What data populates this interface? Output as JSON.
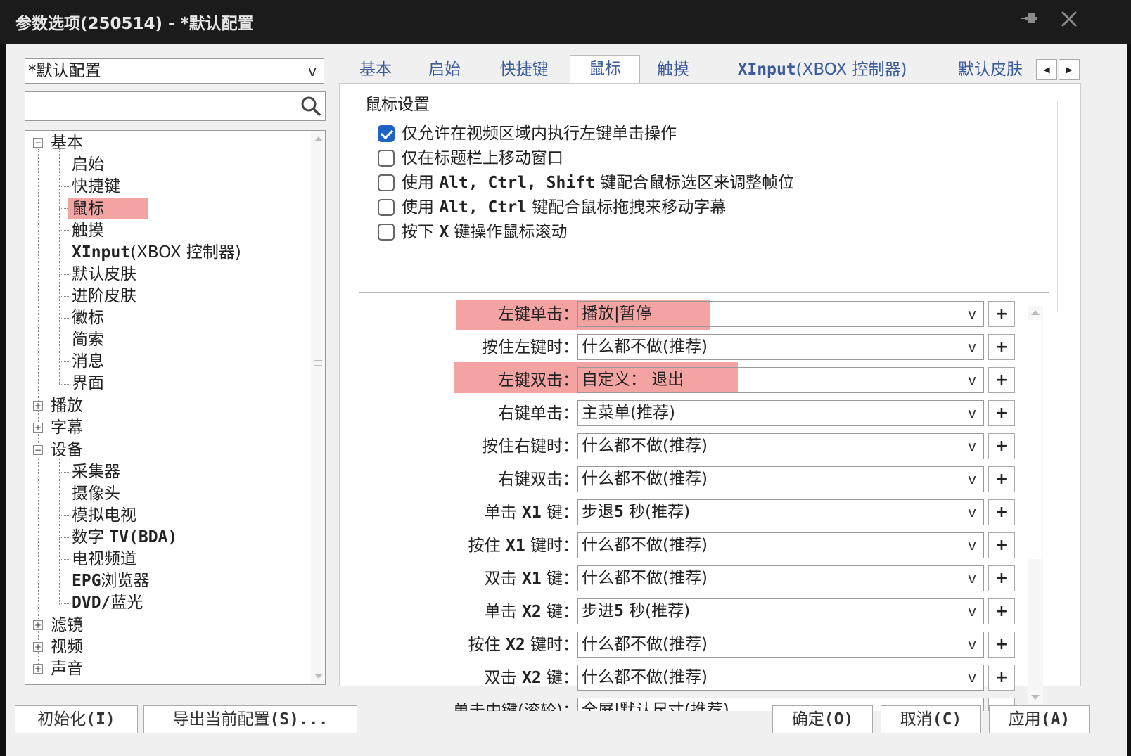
{
  "window": {
    "title": "参数选项(250514) - *默认配置"
  },
  "profile": {
    "selected": "*默认配置"
  },
  "search": {
    "placeholder": ""
  },
  "tree": {
    "basic": "基本",
    "basic_children": [
      "启始",
      "快捷键",
      "鼠标",
      "触摸",
      "XInput",
      "(XBOX 控制器)",
      "默认皮肤",
      "进阶皮肤",
      "徽标",
      "简索",
      "消息",
      "界面"
    ],
    "play": "播放",
    "subtitle": "字幕",
    "device": "设备",
    "device_children": [
      "采集器",
      "摄像头",
      "模拟电视",
      "数字 ",
      "TV(BDA)",
      "电视频道",
      "EPG",
      "浏览器",
      "DVD/",
      "蓝光"
    ],
    "filter": "滤镜",
    "video": "视频",
    "audio": "声音"
  },
  "tabs": {
    "basic": "基本",
    "start": "启始",
    "hotkey": "快捷键",
    "mouse": "鼠标",
    "touch": "触摸",
    "xinput": "XInput",
    "xinput_suffix": "(XBOX 控制器)",
    "skin": "默认皮肤"
  },
  "mouse": {
    "group_title": "鼠标设置",
    "options": [
      {
        "label": "仅允许在视频区域内执行左键单击操作",
        "checked": true
      },
      {
        "label": "仅在标题栏上移动窗口",
        "checked": false
      },
      {
        "label_pre": "使用 ",
        "label_keys": "Alt, Ctrl, Shift",
        "label_post": " 键配合鼠标选区来调整帧位",
        "checked": false
      },
      {
        "label_pre": "使用 ",
        "label_keys": "Alt, Ctrl",
        "label_post": " 键配合鼠标拖拽来移动字幕",
        "checked": false
      },
      {
        "label_pre": "按下 ",
        "label_keys": "X",
        "label_post": " 键操作鼠标滚动",
        "checked": false
      }
    ],
    "mappings": [
      {
        "label": "左键单击：",
        "value": "播放|暂停"
      },
      {
        "label": "按住左键时：",
        "value": "什么都不做(推荐)"
      },
      {
        "label": "左键双击：",
        "value": "自定义：  退出"
      },
      {
        "label": "右键单击：",
        "value": "主菜单(推荐)"
      },
      {
        "label": "按住右键时：",
        "value": "什么都不做(推荐)"
      },
      {
        "label": "右键双击：",
        "value": "什么都不做(推荐)"
      },
      {
        "label_pre": "单击 ",
        "label_key": "X1",
        "label_post": " 键：",
        "value_pre": "步退",
        "value_num": "5",
        "value_post": " 秒(推荐)"
      },
      {
        "label_pre": "按住 ",
        "label_key": "X1",
        "label_post": " 键时：",
        "value": "什么都不做(推荐)"
      },
      {
        "label_pre": "双击 ",
        "label_key": "X1",
        "label_post": " 键：",
        "value": "什么都不做(推荐)"
      },
      {
        "label_pre": "单击 ",
        "label_key": "X2",
        "label_post": " 键：",
        "value_pre": "步进",
        "value_num": "5",
        "value_post": " 秒(推荐)"
      },
      {
        "label_pre": "按住 ",
        "label_key": "X2",
        "label_post": " 键时：",
        "value": "什么都不做(推荐)"
      },
      {
        "label_pre": "双击 ",
        "label_key": "X2",
        "label_post": " 键：",
        "value": "什么都不做(推荐)"
      },
      {
        "label": "单击中键(滚轮)：",
        "value": "全屏|默认尺寸(推荐)"
      }
    ],
    "plus": "+",
    "arrow": "v"
  },
  "buttons": {
    "init": "初始化",
    "init_key": "(I)",
    "export": "导出当前配置",
    "export_key": "(S)...",
    "ok": "确定",
    "ok_key": "(O)",
    "cancel": "取消",
    "cancel_key": "(C)",
    "apply": "应用",
    "apply_key": "(A)"
  },
  "icons": {
    "pin": "pin-icon",
    "close": "close-icon",
    "search": "search-icon"
  }
}
